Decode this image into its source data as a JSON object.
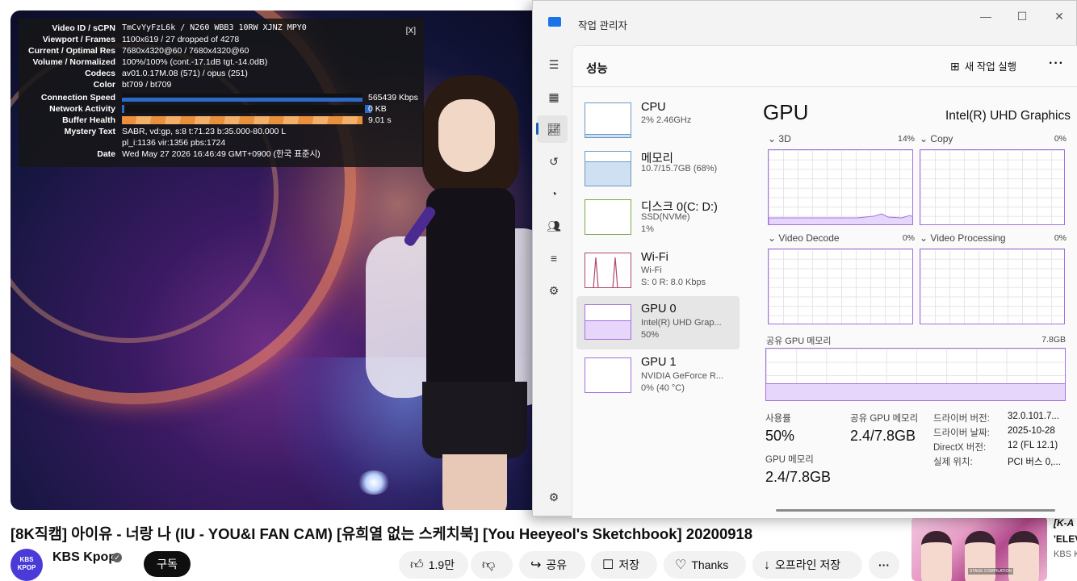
{
  "video": {
    "stats": {
      "close_label": "[X]",
      "rows": [
        {
          "key": "Video ID / sCPN",
          "value": "TmCvYyFzL6k / N260 WBB3 10RW XJNZ MPY0"
        },
        {
          "key": "Viewport / Frames",
          "value": "1100x619 / 27 dropped of 4278"
        },
        {
          "key": "Current / Optimal Res",
          "value": "7680x4320@60 / 7680x4320@60"
        },
        {
          "key": "Volume / Normalized",
          "value": "100%/100% (cont.-17.1dB tgt.-14.0dB)"
        },
        {
          "key": "Codecs",
          "value": "av01.0.17M.08 (571) / opus (251)"
        },
        {
          "key": "Color",
          "value": "bt709 / bt709"
        },
        {
          "key": "Connection Speed",
          "value": "565439 Kbps"
        },
        {
          "key": "Network Activity",
          "value": "0 KB"
        },
        {
          "key": "Buffer Health",
          "value": "9.01 s"
        },
        {
          "key": "Mystery Text",
          "value": "SABR, vd:gp, s:8 t:71.23 b:35.000-80.000 L"
        },
        {
          "key": "",
          "value": "pl_i:1136 vir:1356 pbs:1724"
        },
        {
          "key": "Date",
          "value": "Wed May 27 2026 16:46:49 GMT+0900 (한국 표준시)"
        }
      ]
    },
    "title": "[8K직캠] 아이유 - 너랑 나 (IU - YOU&I FAN CAM) [유희열 없는 스케치북] [You Heeyeol's Sketchbook] 20200918",
    "channel": {
      "avatar_text": "KBS KPOP",
      "name": "KBS Kpop",
      "verified_icon": "checkmark-icon",
      "subscribe_label": "구독"
    },
    "actions": {
      "like_label": "1.9만",
      "share_label": "공유",
      "save_label": "저장",
      "thanks_label": "Thanks",
      "download_label": "오프라인 저장",
      "more_label": "···"
    },
    "recommended": {
      "title_line1": "[K-A",
      "title_line2": "'ELEV",
      "channel": "KBS K",
      "badge": "STAGE COMPILATION"
    }
  },
  "task_manager": {
    "window_title": "작업 관리자",
    "page_title": "성능",
    "run_new_task_label": "새 작업 실행",
    "more_label": "···",
    "nav_icons": [
      "hamburger-icon",
      "processes-icon",
      "performance-icon",
      "app-history-icon",
      "startup-apps-icon",
      "users-icon",
      "details-icon",
      "services-icon",
      "settings-icon"
    ],
    "devices": [
      {
        "name": "CPU",
        "sub1": "2% 2.46GHz",
        "sub2": ""
      },
      {
        "name": "메모리",
        "sub1": "10.7/15.7GB (68%)",
        "sub2": ""
      },
      {
        "name": "디스크 0(C: D:)",
        "sub1": "SSD(NVMe)",
        "sub2": "1%"
      },
      {
        "name": "Wi-Fi",
        "sub1": "Wi-Fi",
        "sub2": "S: 0 R: 8.0 Kbps"
      },
      {
        "name": "GPU 0",
        "sub1": "Intel(R) UHD Grap...",
        "sub2": "50%"
      },
      {
        "name": "GPU 1",
        "sub1": "NVIDIA GeForce R...",
        "sub2": "0% (40 °C)"
      }
    ],
    "gpu": {
      "heading": "GPU",
      "model": "Intel(R) UHD Graphics",
      "engines": [
        {
          "label": "3D",
          "pct": "14%"
        },
        {
          "label": "Copy",
          "pct": "0%"
        },
        {
          "label": "Video Decode",
          "pct": "0%"
        },
        {
          "label": "Video Processing",
          "pct": "0%"
        }
      ],
      "shared_memory_label": "공유 GPU 메모리",
      "shared_memory_max": "7.8GB",
      "shared_memory_fraction": 0.31,
      "utilization_label": "사용률",
      "utilization_value": "50%",
      "shared_label": "공유 GPU 메모리",
      "shared_value": "2.4/7.8GB",
      "gpu_memory_label": "GPU 메모리",
      "gpu_memory_value": "2.4/7.8GB",
      "properties": [
        {
          "k": "드라이버 버전:",
          "v": "32.0.101.7..."
        },
        {
          "k": "드라이버 날짜:",
          "v": "2025-10-28"
        },
        {
          "k": "DirectX 버전:",
          "v": "12 (FL 12.1)"
        },
        {
          "k": "실제 위치:",
          "v": "PCI 버스 0,..."
        }
      ]
    },
    "accent_purple": "#a56fe0",
    "accent_blue": "#6b9ac4"
  }
}
